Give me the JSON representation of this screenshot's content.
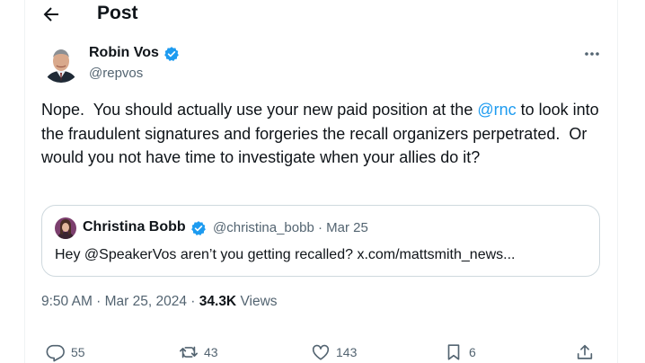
{
  "header": {
    "title": "Post",
    "back_icon": "arrow-left-icon"
  },
  "post": {
    "author": {
      "name": "Robin Vos",
      "handle": "@repvos",
      "verified": true,
      "avatar_icon": "user-avatar"
    },
    "text_part1": "Nope.  You should actually use your new paid position at the ",
    "mention": "@rnc",
    "text_part2": " to look into the fraudulent signatures and forgeries the recall organizers perpetrated.  Or would you not have time to investigate when your allies do it?",
    "more_icon": "more-horizontal-icon",
    "quote": {
      "name": "Christina Bobb",
      "handle_line": "@christina_bobb · Mar 25",
      "text": "Hey @SpeakerVos aren’t you getting recalled? x.com/mattsmith_news...",
      "verified": true
    },
    "meta": {
      "time_date": "9:50 AM · Mar 25, 2024 · ",
      "views_count": "34.3K",
      "views_label": " Views"
    },
    "actions": {
      "replies": "55",
      "reposts": "43",
      "likes": "143",
      "bookmarks": "6"
    }
  },
  "colors": {
    "accent": "#1d9bf0",
    "text": "#0f1419",
    "secondary": "#536471",
    "border": "#cfd9de"
  }
}
